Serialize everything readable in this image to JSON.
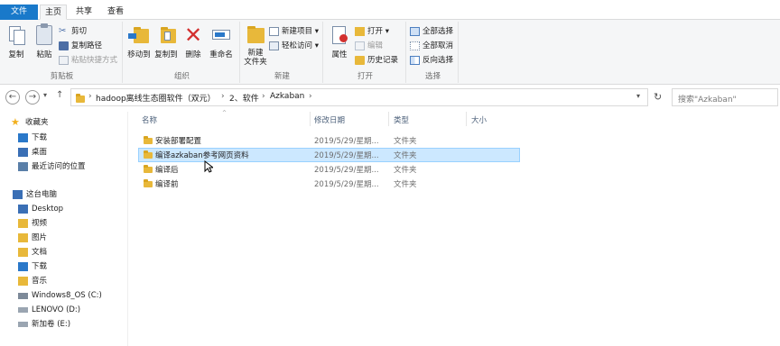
{
  "tabs": [
    "文件",
    "主页",
    "共享",
    "查看"
  ],
  "ribbon": {
    "clipboard": {
      "label": "剪贴板",
      "copy": "复制",
      "paste": "粘贴",
      "cut": "剪切",
      "copy_path": "复制路径",
      "paste_shortcut": "粘贴快捷方式"
    },
    "organize": {
      "label": "组织",
      "move_to": "移动到",
      "copy_to": "复制到",
      "delete": "删除",
      "rename": "重命名"
    },
    "new": {
      "label": "新建",
      "new_folder": "新建\n文件夹",
      "new_item": "新建项目 ▾",
      "easy_access": "轻松访问 ▾"
    },
    "open": {
      "label": "打开",
      "properties": "属性",
      "open": "打开 ▾",
      "edit": "编辑",
      "history": "历史记录"
    },
    "select": {
      "label": "选择",
      "select_all": "全部选择",
      "select_none": "全部取消",
      "invert": "反向选择"
    }
  },
  "address": {
    "crumbs": [
      "hadoop离线生态圈软件（双元）",
      "2、软件",
      "Azkaban"
    ],
    "search_placeholder": "搜索\"Azkaban\""
  },
  "sidebar": {
    "quick_access": "收藏夹",
    "quick_items": [
      "下载",
      "桌面",
      "最近访问的位置"
    ],
    "this_pc": "这台电脑",
    "pc_items": [
      "Desktop",
      "视频",
      "图片",
      "文档",
      "下载",
      "音乐",
      "Windows8_OS (C:)",
      "LENOVO (D:)",
      "新加卷 (E:)"
    ]
  },
  "columns": {
    "name": "名称",
    "date": "修改日期",
    "type": "类型",
    "size": "大小"
  },
  "files": [
    {
      "name": "安装部署配置",
      "date": "2019/5/29/星期...",
      "type": "文件夹"
    },
    {
      "name": "编译azkaban参考网页资料",
      "date": "2019/5/29/星期...",
      "type": "文件夹"
    },
    {
      "name": "编译后",
      "date": "2019/5/29/星期...",
      "type": "文件夹"
    },
    {
      "name": "编译前",
      "date": "2019/5/29/星期...",
      "type": "文件夹"
    }
  ],
  "selected_index": 1,
  "colors": {
    "accent": "#1979ca",
    "folder": "#e8b83a",
    "selection": "#cce8ff"
  }
}
